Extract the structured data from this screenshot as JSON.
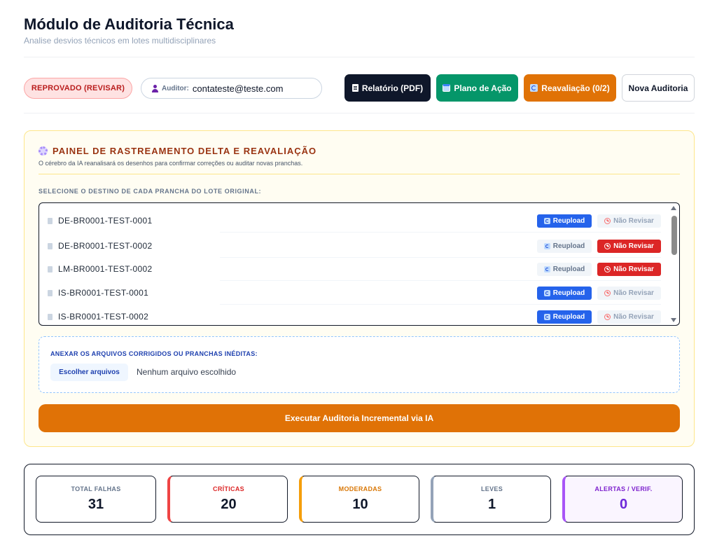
{
  "header": {
    "title": "Módulo de Auditoria Técnica",
    "subtitle": "Analise desvios técnicos em lotes multidisciplinares"
  },
  "toolbar": {
    "status_badge": "REPROVADO (REVISAR)",
    "auditor_label": "Auditor:",
    "auditor_email": "contateste@teste.com",
    "report_label": "Relatório (PDF)",
    "plan_label": "Plano de Ação",
    "reeval_label": "Reavaliação (0/2)",
    "new_label": "Nova Auditoria"
  },
  "delta_panel": {
    "title": "PAINEL DE RASTREAMENTO DELTA E REAVALIAÇÃO",
    "description": "O cérebro da IA reanalisará os desenhos para confirmar correções ou auditar novas pranchas.",
    "select_label": "SELECIONE O DESTINO DE CADA PRANCHA DO LOTE ORIGINAL:",
    "reupload_label": "Reupload",
    "skip_label": "Não Revisar",
    "sheets": [
      {
        "name": "DE-BR0001-TEST-0001",
        "selected": "reupload"
      },
      {
        "name": "DE-BR0001-TEST-0002",
        "selected": "skip"
      },
      {
        "name": "LM-BR0001-TEST-0002",
        "selected": "skip"
      },
      {
        "name": "IS-BR0001-TEST-0001",
        "selected": "reupload"
      },
      {
        "name": "IS-BR0001-TEST-0002",
        "selected": "reupload"
      }
    ],
    "attach_label": "ANEXAR OS ARQUIVOS CORRIGIDOS OU PRANCHAS INÉDITAS:",
    "choose_files_label": "Escolher arquivos",
    "no_file_text": "Nenhum arquivo escolhido",
    "run_button": "Executar Auditoria Incremental via IA"
  },
  "stats": {
    "total": {
      "label": "TOTAL FALHAS",
      "value": "31"
    },
    "critical": {
      "label": "CRÍTICAS",
      "value": "20"
    },
    "moderate": {
      "label": "MODERADAS",
      "value": "10"
    },
    "light": {
      "label": "LEVES",
      "value": "1"
    },
    "alerts": {
      "label": "ALERTAS / VERIF.",
      "value": "0"
    }
  },
  "colors": {
    "accent_orange": "#e07206",
    "upload_blue": "#2563eb",
    "skip_red": "#dc2626",
    "plan_green": "#059669"
  }
}
